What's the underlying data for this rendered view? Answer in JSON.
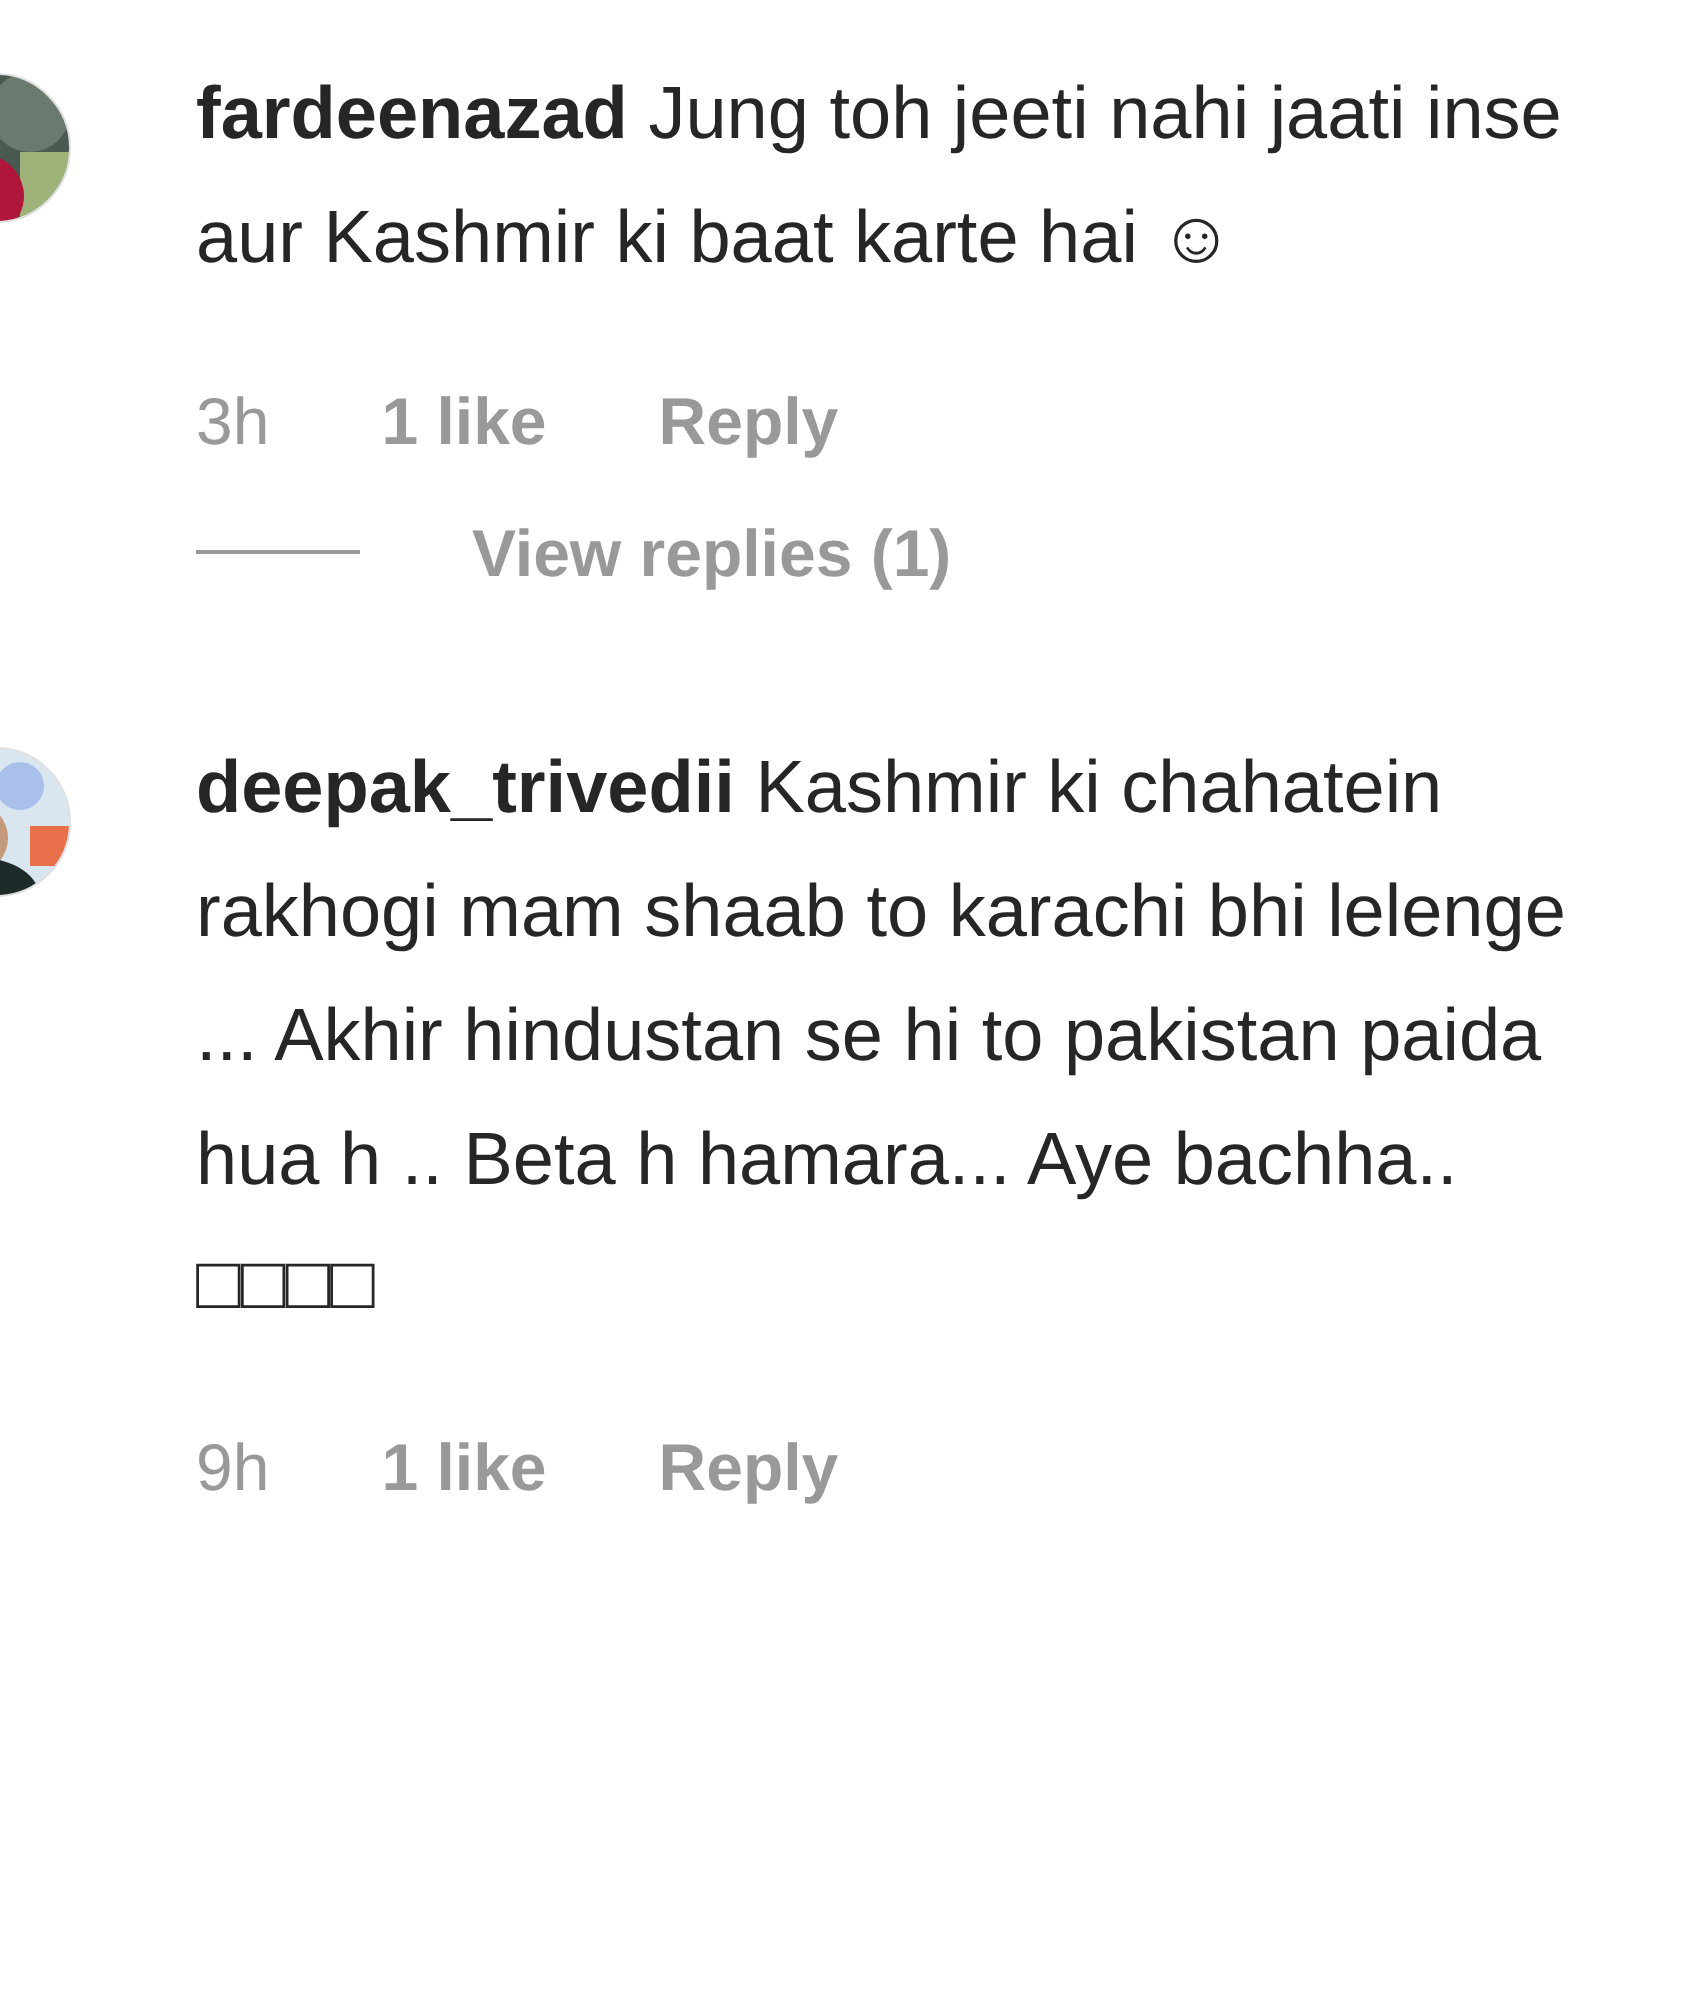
{
  "comments": [
    {
      "username": "fardeenazad",
      "text": "Jung toh jeeti nahi jaati inse aur Kashmir ki baat karte hai ☺",
      "time": "3h",
      "likes": "1 like",
      "reply": "Reply",
      "view_replies": "View replies (1)"
    },
    {
      "username": "deepak_trivedii",
      "text": "Kashmir ki chahatein rakhogi mam shaab to karachi bhi lelenge ... Akhir hindustan se hi to pakistan paida hua h .. Beta h hamara... Aye bachha.. □□□□",
      "time": "9h",
      "likes": "1 like",
      "reply": "Reply"
    }
  ]
}
